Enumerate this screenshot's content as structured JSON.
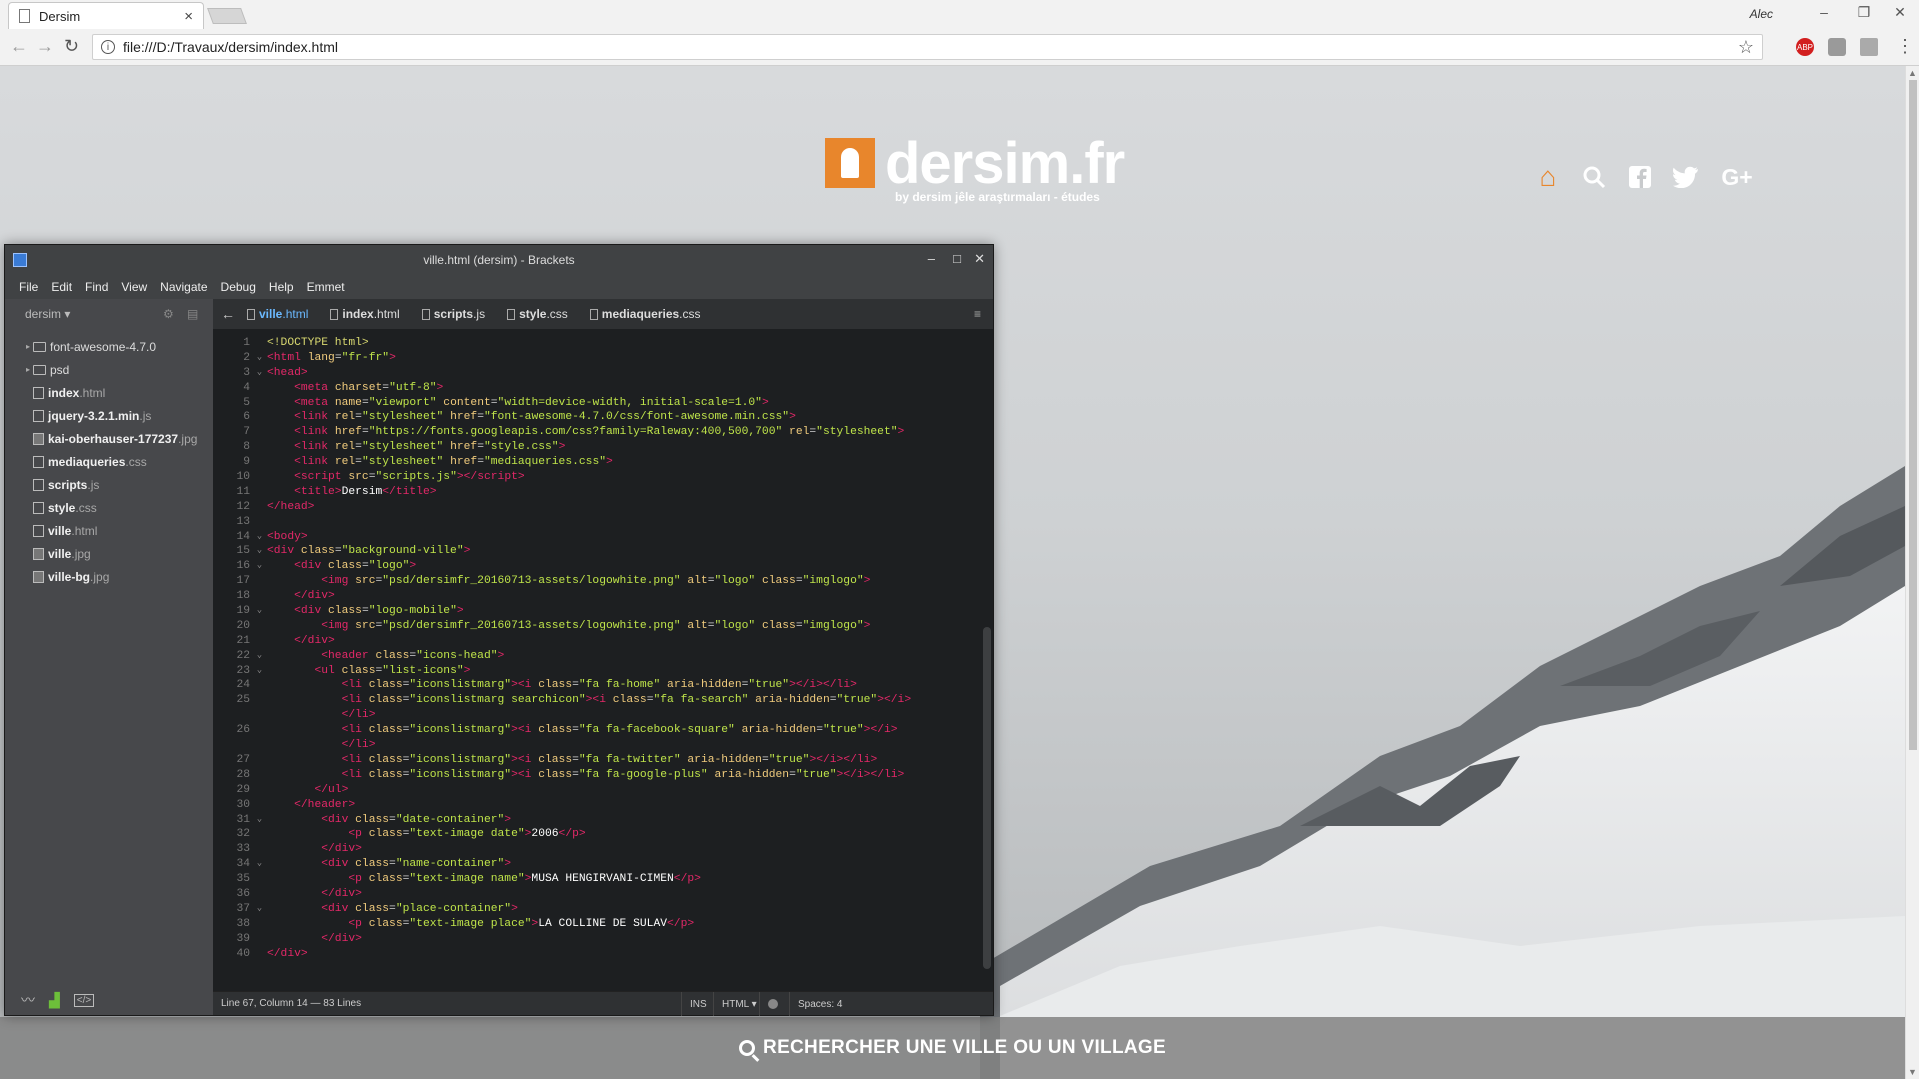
{
  "browser": {
    "tab_title": "Dersim",
    "tab_close": "×",
    "profile_name": "Alec",
    "url": "file:///D:/Travaux/dersim/index.html",
    "window_minimize": "–",
    "window_restore": "❐",
    "window_close": "✕",
    "back_glyph": "←",
    "forward_glyph": "→",
    "reload_glyph": "↻",
    "info_glyph": "i",
    "star_glyph": "☆",
    "ext_abp": "ABP",
    "menu_glyph": "⋮"
  },
  "site": {
    "logo_text": "dersim.fr",
    "logo_subtitle": "by dersim jêle araştırmaları - études",
    "header_icons": [
      {
        "name": "home-icon",
        "glyph": "⌂",
        "color": "#e8862c"
      },
      {
        "name": "search-icon",
        "glyph": "⚲",
        "color": "#ffffff"
      },
      {
        "name": "facebook-icon",
        "glyph": "f",
        "color": "#ffffff"
      },
      {
        "name": "twitter-icon",
        "glyph": "t",
        "color": "#ffffff"
      },
      {
        "name": "google-plus-icon",
        "glyph": "G+",
        "color": "#ffffff"
      }
    ],
    "search_bar_label": "RECHERCHER UNE VILLE OU UN VILLAGE",
    "accent_color": "#e8862c"
  },
  "brackets": {
    "window_title": "ville.html (dersim) - Brackets",
    "win_min": "–",
    "win_max": "□",
    "win_close": "✕",
    "menu": [
      "File",
      "Edit",
      "Find",
      "View",
      "Navigate",
      "Debug",
      "Help",
      "Emmet"
    ],
    "project_name": "dersim ▾",
    "gear_glyph": "⚙",
    "split_glyph": "▤",
    "tree": [
      {
        "type": "folder",
        "name": "font-awesome-4.7.0",
        "ext": ""
      },
      {
        "type": "folder",
        "name": "psd",
        "ext": ""
      },
      {
        "type": "file",
        "name": "index",
        "ext": ".html"
      },
      {
        "type": "file",
        "name": "jquery-3.2.1.min",
        "ext": ".js"
      },
      {
        "type": "image",
        "name": "kai-oberhauser-177237",
        "ext": ".jpg"
      },
      {
        "type": "file",
        "name": "mediaqueries",
        "ext": ".css"
      },
      {
        "type": "file",
        "name": "scripts",
        "ext": ".js"
      },
      {
        "type": "file",
        "name": "style",
        "ext": ".css"
      },
      {
        "type": "file",
        "name": "ville",
        "ext": ".html"
      },
      {
        "type": "image",
        "name": "ville",
        "ext": ".jpg"
      },
      {
        "type": "image",
        "name": "ville-bg",
        "ext": ".jpg"
      }
    ],
    "tabs": [
      {
        "name": "ville",
        "ext": ".html",
        "active": true
      },
      {
        "name": "index",
        "ext": ".html",
        "active": false
      },
      {
        "name": "scripts",
        "ext": ".js",
        "active": false
      },
      {
        "name": "style",
        "ext": ".css",
        "active": false
      },
      {
        "name": "mediaqueries",
        "ext": ".css",
        "active": false
      }
    ],
    "back_arrow": "←",
    "tabs_menu_glyph": "≡",
    "code_lines": [
      {
        "n": "1",
        "f": "",
        "h": "<span class=\"dt\">&lt;!DOCTYPE html&gt;</span>"
      },
      {
        "n": "2",
        "f": "v",
        "h": "<span class=\"tg\">&lt;html</span> <span class=\"at\">lang</span>=<span class=\"av\">\"fr-fr\"</span><span class=\"tg\">&gt;</span>"
      },
      {
        "n": "3",
        "f": "v",
        "h": "<span class=\"tg\">&lt;head&gt;</span>"
      },
      {
        "n": "4",
        "f": "",
        "h": "    <span class=\"tg\">&lt;meta</span> <span class=\"at\">charset</span>=<span class=\"av\">\"utf-8\"</span><span class=\"tg\">&gt;</span>"
      },
      {
        "n": "5",
        "f": "",
        "h": "    <span class=\"tg\">&lt;meta</span> <span class=\"at\">name</span>=<span class=\"av\">\"viewport\"</span> <span class=\"at\">content</span>=<span class=\"av\">\"width=device-width, initial-scale=1.0\"</span><span class=\"tg\">&gt;</span>"
      },
      {
        "n": "6",
        "f": "",
        "h": "    <span class=\"tg\">&lt;link</span> <span class=\"at\">rel</span>=<span class=\"av\">\"stylesheet\"</span> <span class=\"at\">href</span>=<span class=\"av\">\"font-awesome-4.7.0/css/font-awesome.min.css\"</span><span class=\"tg\">&gt;</span>"
      },
      {
        "n": "7",
        "f": "",
        "h": "    <span class=\"tg\">&lt;link</span> <span class=\"at\">href</span>=<span class=\"av\">\"https://fonts.googleapis.com/css?family=Raleway:400,500,700\"</span> <span class=\"at\">rel</span>=<span class=\"av\">\"stylesheet\"</span><span class=\"tg\">&gt;</span>"
      },
      {
        "n": "8",
        "f": "",
        "h": "    <span class=\"tg\">&lt;link</span> <span class=\"at\">rel</span>=<span class=\"av\">\"stylesheet\"</span> <span class=\"at\">href</span>=<span class=\"av\">\"style.css\"</span><span class=\"tg\">&gt;</span>"
      },
      {
        "n": "9",
        "f": "",
        "h": "    <span class=\"tg\">&lt;link</span> <span class=\"at\">rel</span>=<span class=\"av\">\"stylesheet\"</span> <span class=\"at\">href</span>=<span class=\"av\">\"mediaqueries.css\"</span><span class=\"tg\">&gt;</span>"
      },
      {
        "n": "10",
        "f": "",
        "h": "    <span class=\"tg\">&lt;script</span> <span class=\"at\">src</span>=<span class=\"av\">\"scripts.js\"</span><span class=\"tg\">&gt;&lt;/script&gt;</span>"
      },
      {
        "n": "11",
        "f": "",
        "h": "    <span class=\"tg\">&lt;title&gt;</span><span class=\"tx\">Dersim</span><span class=\"tg\">&lt;/title&gt;</span>"
      },
      {
        "n": "12",
        "f": "",
        "h": "<span class=\"tg\">&lt;/head&gt;</span>"
      },
      {
        "n": "13",
        "f": "",
        "h": ""
      },
      {
        "n": "14",
        "f": "v",
        "h": "<span class=\"tg\">&lt;body&gt;</span>"
      },
      {
        "n": "15",
        "f": "v",
        "h": "<span class=\"tg\">&lt;div</span> <span class=\"at\">class</span>=<span class=\"av\">\"background-ville\"</span><span class=\"tg\">&gt;</span>"
      },
      {
        "n": "16",
        "f": "v",
        "h": "    <span class=\"tg\">&lt;div</span> <span class=\"at\">class</span>=<span class=\"av\">\"logo\"</span><span class=\"tg\">&gt;</span>"
      },
      {
        "n": "17",
        "f": "",
        "h": "        <span class=\"tg\">&lt;img</span> <span class=\"at\">src</span>=<span class=\"av\">\"psd/dersimfr_20160713-assets/logowhite.png\"</span> <span class=\"at\">alt</span>=<span class=\"av\">\"logo\"</span> <span class=\"at\">class</span>=<span class=\"av\">\"imglogo\"</span><span class=\"tg\">&gt;</span>"
      },
      {
        "n": "18",
        "f": "",
        "h": "    <span class=\"tg\">&lt;/div&gt;</span>"
      },
      {
        "n": "19",
        "f": "v",
        "h": "    <span class=\"tg\">&lt;div</span> <span class=\"at\">class</span>=<span class=\"av\">\"logo-mobile\"</span><span class=\"tg\">&gt;</span>"
      },
      {
        "n": "20",
        "f": "",
        "h": "        <span class=\"tg\">&lt;img</span> <span class=\"at\">src</span>=<span class=\"av\">\"psd/dersimfr_20160713-assets/logowhite.png\"</span> <span class=\"at\">alt</span>=<span class=\"av\">\"logo\"</span> <span class=\"at\">class</span>=<span class=\"av\">\"imglogo\"</span><span class=\"tg\">&gt;</span>"
      },
      {
        "n": "21",
        "f": "",
        "h": "    <span class=\"tg\">&lt;/div&gt;</span>"
      },
      {
        "n": "22",
        "f": "v",
        "h": "        <span class=\"tg\">&lt;header</span> <span class=\"at\">class</span>=<span class=\"av\">\"icons-head\"</span><span class=\"tg\">&gt;</span>"
      },
      {
        "n": "23",
        "f": "v",
        "h": "       <span class=\"tg\">&lt;ul</span> <span class=\"at\">class</span>=<span class=\"av\">\"list-icons\"</span><span class=\"tg\">&gt;</span>"
      },
      {
        "n": "24",
        "f": "",
        "h": "           <span class=\"tg\">&lt;li</span> <span class=\"at\">class</span>=<span class=\"av\">\"iconslistmarg\"</span><span class=\"tg\">&gt;&lt;i</span> <span class=\"at\">class</span>=<span class=\"av\">\"fa fa-home\"</span> <span class=\"at\">aria-hidden</span>=<span class=\"av\">\"true\"</span><span class=\"tg\">&gt;&lt;/i&gt;&lt;/li&gt;</span>"
      },
      {
        "n": "25",
        "f": "",
        "h": "           <span class=\"tg\">&lt;li</span> <span class=\"at\">class</span>=<span class=\"av\">\"iconslistmarg searchicon\"</span><span class=\"tg\">&gt;&lt;i</span> <span class=\"at\">class</span>=<span class=\"av\">\"fa fa-search\"</span> <span class=\"at\">aria-hidden</span>=<span class=\"av\">\"true\"</span><span class=\"tg\">&gt;&lt;/i&gt;</span>"
      },
      {
        "n": "",
        "f": "",
        "h": "           <span class=\"tg\">&lt;/li&gt;</span>"
      },
      {
        "n": "26",
        "f": "",
        "h": "           <span class=\"tg\">&lt;li</span> <span class=\"at\">class</span>=<span class=\"av\">\"iconslistmarg\"</span><span class=\"tg\">&gt;&lt;i</span> <span class=\"at\">class</span>=<span class=\"av\">\"fa fa-facebook-square\"</span> <span class=\"at\">aria-hidden</span>=<span class=\"av\">\"true\"</span><span class=\"tg\">&gt;&lt;/i&gt;</span>"
      },
      {
        "n": "",
        "f": "",
        "h": "           <span class=\"tg\">&lt;/li&gt;</span>"
      },
      {
        "n": "27",
        "f": "",
        "h": "           <span class=\"tg\">&lt;li</span> <span class=\"at\">class</span>=<span class=\"av\">\"iconslistmarg\"</span><span class=\"tg\">&gt;&lt;i</span> <span class=\"at\">class</span>=<span class=\"av\">\"fa fa-twitter\"</span> <span class=\"at\">aria-hidden</span>=<span class=\"av\">\"true\"</span><span class=\"tg\">&gt;&lt;/i&gt;&lt;/li&gt;</span>"
      },
      {
        "n": "28",
        "f": "",
        "h": "           <span class=\"tg\">&lt;li</span> <span class=\"at\">class</span>=<span class=\"av\">\"iconslistmarg\"</span><span class=\"tg\">&gt;&lt;i</span> <span class=\"at\">class</span>=<span class=\"av\">\"fa fa-google-plus\"</span> <span class=\"at\">aria-hidden</span>=<span class=\"av\">\"true\"</span><span class=\"tg\">&gt;&lt;/i&gt;&lt;/li&gt;</span>"
      },
      {
        "n": "29",
        "f": "",
        "h": "       <span class=\"tg\">&lt;/ul&gt;</span>"
      },
      {
        "n": "30",
        "f": "",
        "h": "    <span class=\"tg\">&lt;/header&gt;</span>"
      },
      {
        "n": "31",
        "f": "v",
        "h": "        <span class=\"tg\">&lt;div</span> <span class=\"at\">class</span>=<span class=\"av\">\"date-container\"</span><span class=\"tg\">&gt;</span>"
      },
      {
        "n": "32",
        "f": "",
        "h": "            <span class=\"tg\">&lt;p</span> <span class=\"at\">class</span>=<span class=\"av\">\"text-image date\"</span><span class=\"tg\">&gt;</span><span class=\"tx\">2006</span><span class=\"tg\">&lt;/p&gt;</span>"
      },
      {
        "n": "33",
        "f": "",
        "h": "        <span class=\"tg\">&lt;/div&gt;</span>"
      },
      {
        "n": "34",
        "f": "v",
        "h": "        <span class=\"tg\">&lt;div</span> <span class=\"at\">class</span>=<span class=\"av\">\"name-container\"</span><span class=\"tg\">&gt;</span>"
      },
      {
        "n": "35",
        "f": "",
        "h": "            <span class=\"tg\">&lt;p</span> <span class=\"at\">class</span>=<span class=\"av\">\"text-image name\"</span><span class=\"tg\">&gt;</span><span class=\"tx\">MUSA HENGIRVANI-CIMEN</span><span class=\"tg\">&lt;/p&gt;</span>"
      },
      {
        "n": "36",
        "f": "",
        "h": "        <span class=\"tg\">&lt;/div&gt;</span>"
      },
      {
        "n": "37",
        "f": "v",
        "h": "        <span class=\"tg\">&lt;div</span> <span class=\"at\">class</span>=<span class=\"av\">\"place-container\"</span><span class=\"tg\">&gt;</span>"
      },
      {
        "n": "38",
        "f": "",
        "h": "            <span class=\"tg\">&lt;p</span> <span class=\"at\">class</span>=<span class=\"av\">\"text-image place\"</span><span class=\"tg\">&gt;</span><span class=\"tx\">LA COLLINE DE SULAV</span><span class=\"tg\">&lt;/p&gt;</span>"
      },
      {
        "n": "39",
        "f": "",
        "h": "        <span class=\"tg\">&lt;/div&gt;</span>"
      },
      {
        "n": "40",
        "f": "",
        "h": "<span class=\"tg\">&lt;/div&gt;</span>"
      }
    ],
    "status": {
      "cursor": "Line 67, Column 14 — 83 Lines",
      "mode": "INS",
      "language": "HTML ▾",
      "spaces": "Spaces: 4"
    }
  }
}
